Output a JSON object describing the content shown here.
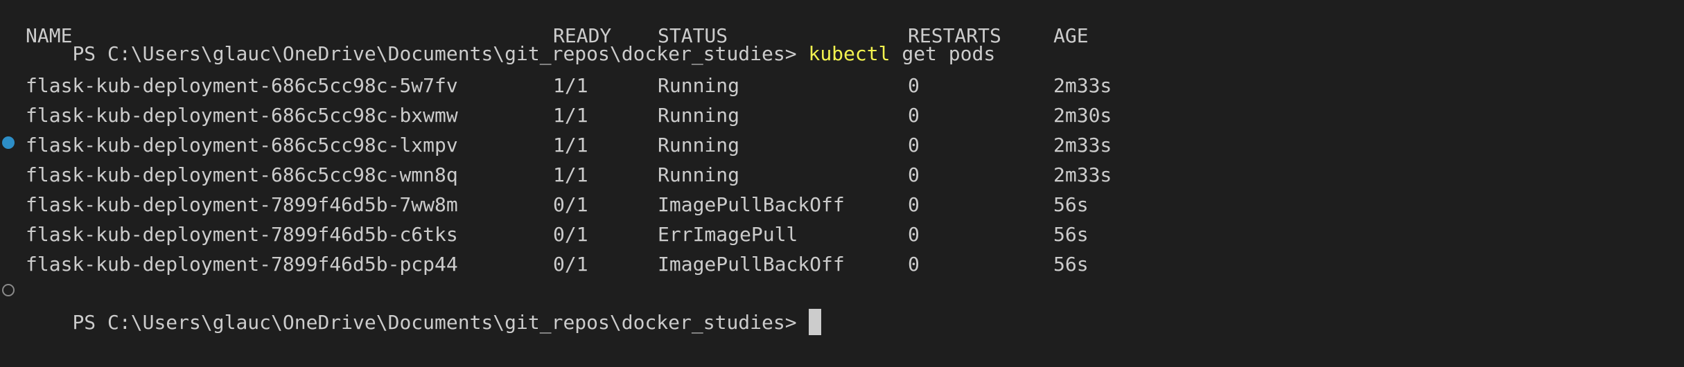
{
  "terminal": {
    "prompt": "PS C:\\Users\\glauc\\OneDrive\\Documents\\git_repos\\docker_studies>",
    "command": {
      "program": "kubectl",
      "args": "get pods"
    },
    "table": {
      "headers": {
        "name": "NAME",
        "ready": "READY",
        "status": "STATUS",
        "restarts": "RESTARTS",
        "age": "AGE"
      },
      "rows": [
        {
          "name": "flask-kub-deployment-686c5cc98c-5w7fv",
          "ready": "1/1",
          "status": "Running",
          "restarts": "0",
          "age": "2m33s"
        },
        {
          "name": "flask-kub-deployment-686c5cc98c-bxwmw",
          "ready": "1/1",
          "status": "Running",
          "restarts": "0",
          "age": "2m30s"
        },
        {
          "name": "flask-kub-deployment-686c5cc98c-lxmpv",
          "ready": "1/1",
          "status": "Running",
          "restarts": "0",
          "age": "2m33s"
        },
        {
          "name": "flask-kub-deployment-686c5cc98c-wmn8q",
          "ready": "1/1",
          "status": "Running",
          "restarts": "0",
          "age": "2m33s"
        },
        {
          "name": "flask-kub-deployment-7899f46d5b-7ww8m",
          "ready": "0/1",
          "status": "ImagePullBackOff",
          "restarts": "0",
          "age": "56s"
        },
        {
          "name": "flask-kub-deployment-7899f46d5b-c6tks",
          "ready": "0/1",
          "status": "ErrImagePull",
          "restarts": "0",
          "age": "56s"
        },
        {
          "name": "flask-kub-deployment-7899f46d5b-pcp44",
          "ready": "0/1",
          "status": "ImagePullBackOff",
          "restarts": "0",
          "age": "56s"
        }
      ]
    },
    "colors": {
      "background": "#1e1e1e",
      "text": "#cccccc",
      "command_highlight": "#f2f24f",
      "success_marker": "#2d8ec7"
    }
  }
}
